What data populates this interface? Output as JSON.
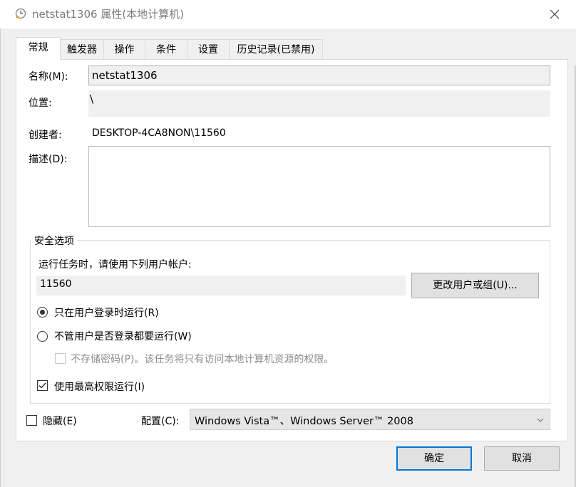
{
  "window": {
    "title": "netstat1306 属性(本地计算机)",
    "icon": "task-clock-icon",
    "close_icon": "close-icon"
  },
  "tabs": [
    {
      "label": "常规",
      "active": true
    },
    {
      "label": "触发器",
      "active": false
    },
    {
      "label": "操作",
      "active": false
    },
    {
      "label": "条件",
      "active": false
    },
    {
      "label": "设置",
      "active": false
    },
    {
      "label": "历史记录(已禁用)",
      "active": false
    }
  ],
  "general": {
    "name_label": "名称(M):",
    "name_value": "netstat1306",
    "location_label": "位置:",
    "location_value": "\\",
    "author_label": "创建者:",
    "author_value": "DESKTOP-4CA8NON\\11560",
    "description_label": "描述(D):",
    "description_value": ""
  },
  "security": {
    "group_title": "安全选项",
    "run_as_prompt": "运行任务时，请使用下列用户帐户:",
    "user_account": "11560",
    "change_user_button": "更改用户或组(U)...",
    "radio_logged_on": "只在用户登录时运行(R)",
    "radio_logged_on_selected": true,
    "radio_whether_logged_on": "不管用户是否登录都要运行(W)",
    "radio_whether_logged_on_selected": false,
    "no_store_password": "不存储密码(P)。该任务将只有访问本地计算机资源的权限。",
    "no_store_password_checked": false,
    "highest_privileges": "使用最高权限运行(I)",
    "highest_privileges_checked": true
  },
  "bottom": {
    "hidden_label": "隐藏(E)",
    "hidden_checked": false,
    "configure_label": "配置(C):",
    "configure_value": "Windows Vista™、Windows Server™ 2008"
  },
  "buttons": {
    "ok": "确定",
    "cancel": "取消"
  },
  "colors": {
    "accent": "#0078d7",
    "window_bg": "#f0f0f0",
    "panel_bg": "#ffffff"
  }
}
